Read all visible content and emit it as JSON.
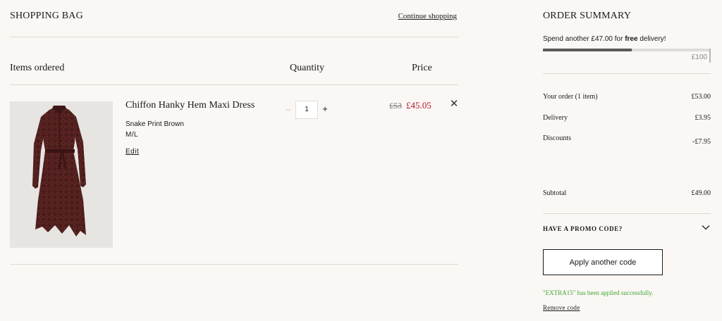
{
  "bag": {
    "title": "SHOPPING BAG",
    "continue_label": "Continue shopping",
    "columns": {
      "items": "Items ordered",
      "quantity": "Quantity",
      "price": "Price"
    },
    "items": [
      {
        "name": "Chiffon Hanky Hem Maxi Dress",
        "variant": "Snake Print Brown",
        "size": "M/L",
        "edit_label": "Edit",
        "qty_minus": "–",
        "quantity": "1",
        "qty_plus": "+",
        "price_original": "£53",
        "price_current": "£45.05",
        "remove_symbol": "✕",
        "image_icon": "dress-image"
      }
    ]
  },
  "summary": {
    "title": "ORDER SUMMARY",
    "delivery": {
      "prefix": "Spend another £47.00 for ",
      "bold": "free",
      "suffix": " delivery!",
      "progress_fraction": 0.53,
      "threshold_label": "£100"
    },
    "rows": [
      {
        "label": "Your order (1 item)",
        "value": "£53.00"
      },
      {
        "label": "Delivery",
        "value": "£3.95"
      },
      {
        "label": "Discounts",
        "value": "-£7.95"
      }
    ],
    "subtotal": {
      "label": "Subtotal",
      "value": "£49.00"
    },
    "promo": {
      "heading": "HAVE A PROMO CODE?",
      "chevron_icon": "chevron-down-icon",
      "apply_label": "Apply another code",
      "success_message": "\"EXTRA15\" has been applied successfully.",
      "remove_label": "Remove code"
    }
  },
  "colors": {
    "background": "#faf7f4",
    "sale_red": "#b3142e",
    "success_green": "#3ea832",
    "progress_fill": "#5a5a5a"
  }
}
